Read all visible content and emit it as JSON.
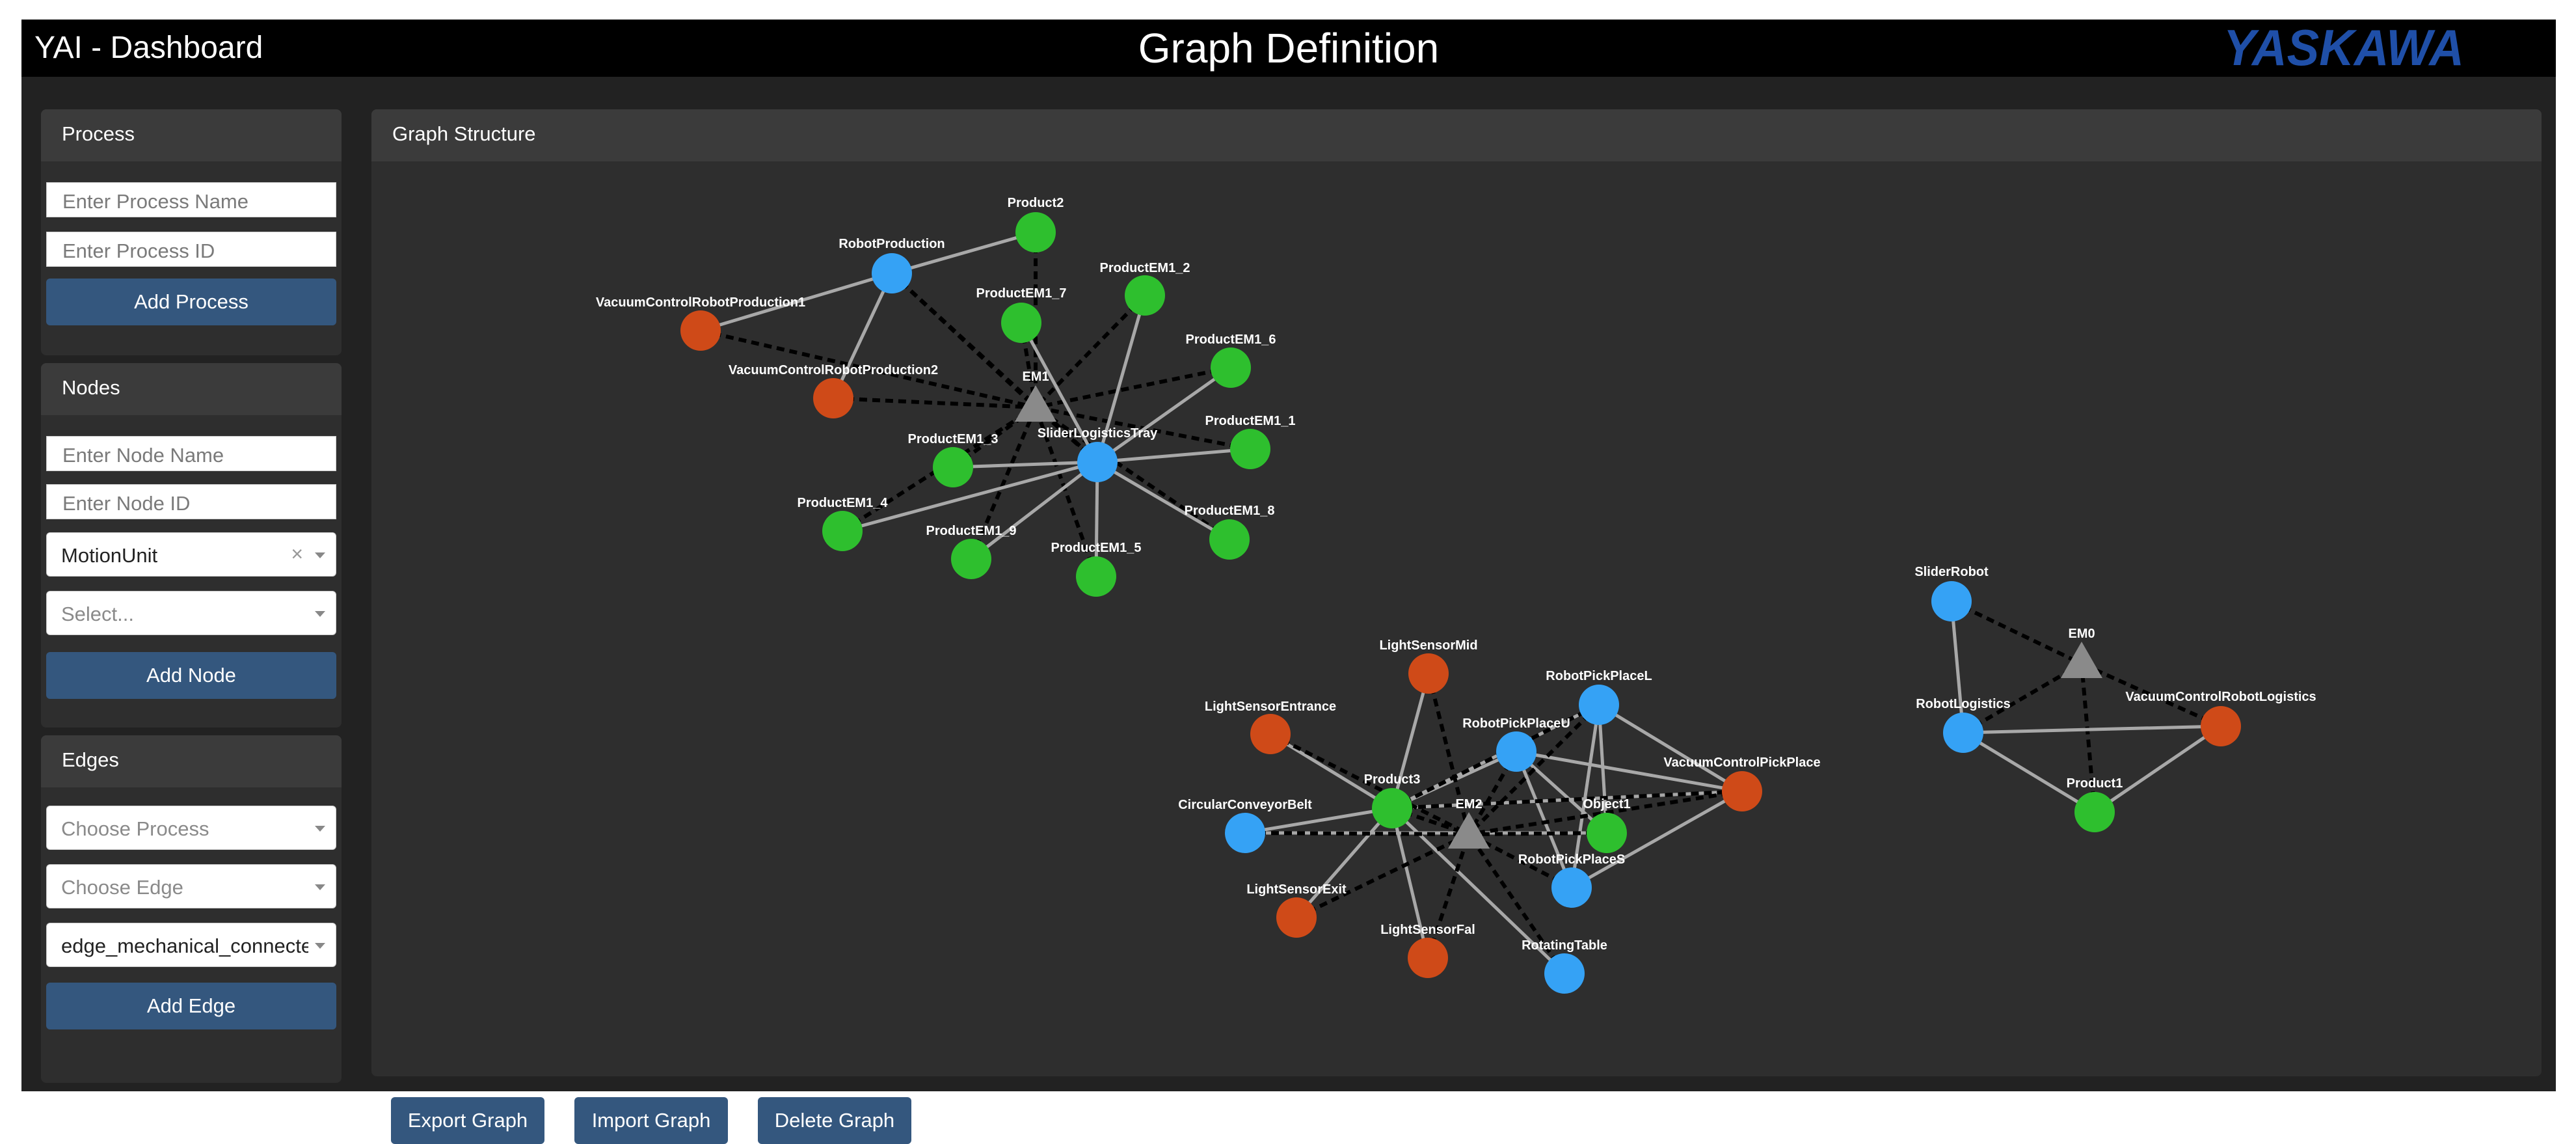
{
  "header": {
    "app_title": "YAI - Dashboard",
    "page_title": "Graph Definition",
    "brand": "YASKAWA"
  },
  "colors": {
    "header_bg": "#000000",
    "panel_bg": "#2e2e2e",
    "panel_header_bg": "#3b3b3b",
    "button_bg": "#34577e",
    "brand_blue": "#1f4fa8",
    "node_blue": "#35a2f5",
    "node_green": "#2ebf2e",
    "node_orange": "#cf4a18",
    "node_gray": "#8a8a8a",
    "edge_solid": "#a8a8a8",
    "edge_dashed": "#000000"
  },
  "sidebar": {
    "process": {
      "title": "Process",
      "name_placeholder": "Enter Process Name",
      "id_placeholder": "Enter Process ID",
      "add_label": "Add Process"
    },
    "nodes": {
      "title": "Nodes",
      "name_placeholder": "Enter Node Name",
      "id_placeholder": "Enter Node ID",
      "type_value": "MotionUnit",
      "clear_glyph": "×",
      "subtype_placeholder": "Select...",
      "add_label": "Add Node"
    },
    "edges": {
      "title": "Edges",
      "process_placeholder": "Choose Process",
      "edge_placeholder": "Choose Edge",
      "edge_type_value": "edge_mechanical_connected",
      "add_label": "Add Edge"
    }
  },
  "main": {
    "title": "Graph Structure",
    "export_label": "Export Graph",
    "import_label": "Import Graph",
    "delete_label": "Delete Graph"
  },
  "graph": {
    "nodes": [
      {
        "id": "Product2",
        "type": "green"
      },
      {
        "id": "RobotProduction",
        "type": "blue"
      },
      {
        "id": "ProductEM1_7",
        "type": "green"
      },
      {
        "id": "ProductEM1_2",
        "type": "green"
      },
      {
        "id": "VacuumControlRobotProduction1",
        "type": "orange"
      },
      {
        "id": "ProductEM1_6",
        "type": "green"
      },
      {
        "id": "VacuumControlRobotProduction2",
        "type": "orange"
      },
      {
        "id": "EM1",
        "type": "gray"
      },
      {
        "id": "SliderLogisticsTray",
        "type": "blue"
      },
      {
        "id": "ProductEM1_1",
        "type": "green"
      },
      {
        "id": "ProductEM1_3",
        "type": "green"
      },
      {
        "id": "ProductEM1_4",
        "type": "green"
      },
      {
        "id": "ProductEM1_8",
        "type": "green"
      },
      {
        "id": "ProductEM1_9",
        "type": "green"
      },
      {
        "id": "ProductEM1_5",
        "type": "green"
      },
      {
        "id": "SliderRobot",
        "type": "blue"
      },
      {
        "id": "EM0",
        "type": "gray"
      },
      {
        "id": "RobotLogistics",
        "type": "blue"
      },
      {
        "id": "VacuumControlRobotLogistics",
        "type": "orange"
      },
      {
        "id": "Product1",
        "type": "green"
      },
      {
        "id": "LightSensorMid",
        "type": "orange"
      },
      {
        "id": "RobotPickPlaceL",
        "type": "blue"
      },
      {
        "id": "LightSensorEntrance",
        "type": "orange"
      },
      {
        "id": "RobotPickPlaceU",
        "type": "blue"
      },
      {
        "id": "VacuumControlPickPlace",
        "type": "orange"
      },
      {
        "id": "Product3",
        "type": "green"
      },
      {
        "id": "CircularConveyorBelt",
        "type": "blue"
      },
      {
        "id": "EM2",
        "type": "gray"
      },
      {
        "id": "Object1",
        "type": "green"
      },
      {
        "id": "RobotPickPlaceS",
        "type": "blue"
      },
      {
        "id": "LightSensorExit",
        "type": "orange"
      },
      {
        "id": "LightSensorFal",
        "type": "orange"
      },
      {
        "id": "RotatingTable",
        "type": "blue"
      }
    ],
    "edges": [
      {
        "from": "RobotProduction",
        "to": "Product2",
        "style": "solid"
      },
      {
        "from": "RobotProduction",
        "to": "VacuumControlRobotProduction1",
        "style": "solid"
      },
      {
        "from": "RobotProduction",
        "to": "VacuumControlRobotProduction2",
        "style": "solid"
      },
      {
        "from": "RobotProduction",
        "to": "SliderLogisticsTray",
        "style": "dashed"
      },
      {
        "from": "RobotProduction",
        "to": "EM1",
        "style": "dashed"
      },
      {
        "from": "VacuumControlRobotProduction1",
        "to": "EM1",
        "style": "dashed"
      },
      {
        "from": "VacuumControlRobotProduction2",
        "to": "EM1",
        "style": "dashed"
      },
      {
        "from": "Product2",
        "to": "EM1",
        "style": "dashed"
      },
      {
        "from": "ProductEM1_7",
        "to": "EM1",
        "style": "dashed"
      },
      {
        "from": "ProductEM1_2",
        "to": "EM1",
        "style": "dashed"
      },
      {
        "from": "ProductEM1_6",
        "to": "EM1",
        "style": "dashed"
      },
      {
        "from": "ProductEM1_1",
        "to": "EM1",
        "style": "dashed"
      },
      {
        "from": "ProductEM1_3",
        "to": "EM1",
        "style": "dashed"
      },
      {
        "from": "ProductEM1_4",
        "to": "EM1",
        "style": "dashed"
      },
      {
        "from": "ProductEM1_8",
        "to": "EM1",
        "style": "dashed"
      },
      {
        "from": "ProductEM1_9",
        "to": "EM1",
        "style": "dashed"
      },
      {
        "from": "ProductEM1_5",
        "to": "EM1",
        "style": "dashed"
      },
      {
        "from": "SliderLogisticsTray",
        "to": "EM1",
        "style": "dashed"
      },
      {
        "from": "SliderLogisticsTray",
        "to": "ProductEM1_7",
        "style": "solid"
      },
      {
        "from": "SliderLogisticsTray",
        "to": "ProductEM1_2",
        "style": "solid"
      },
      {
        "from": "SliderLogisticsTray",
        "to": "ProductEM1_6",
        "style": "solid"
      },
      {
        "from": "SliderLogisticsTray",
        "to": "ProductEM1_1",
        "style": "solid"
      },
      {
        "from": "SliderLogisticsTray",
        "to": "ProductEM1_3",
        "style": "solid"
      },
      {
        "from": "SliderLogisticsTray",
        "to": "ProductEM1_4",
        "style": "solid"
      },
      {
        "from": "SliderLogisticsTray",
        "to": "ProductEM1_8",
        "style": "solid"
      },
      {
        "from": "SliderLogisticsTray",
        "to": "ProductEM1_9",
        "style": "solid"
      },
      {
        "from": "SliderLogisticsTray",
        "to": "ProductEM1_5",
        "style": "solid"
      },
      {
        "from": "SliderRobot",
        "to": "RobotLogistics",
        "style": "solid"
      },
      {
        "from": "SliderRobot",
        "to": "EM0",
        "style": "dashed"
      },
      {
        "from": "RobotLogistics",
        "to": "EM0",
        "style": "dashed"
      },
      {
        "from": "VacuumControlRobotLogistics",
        "to": "EM0",
        "style": "dashed"
      },
      {
        "from": "Product1",
        "to": "EM0",
        "style": "dashed"
      },
      {
        "from": "RobotLogistics",
        "to": "VacuumControlRobotLogistics",
        "style": "solid"
      },
      {
        "from": "RobotLogistics",
        "to": "Product1",
        "style": "solid"
      },
      {
        "from": "Product1",
        "to": "VacuumControlRobotLogistics",
        "style": "solid"
      },
      {
        "from": "LightSensorMid",
        "to": "Product3",
        "style": "solid"
      },
      {
        "from": "LightSensorEntrance",
        "to": "Product3",
        "style": "solid"
      },
      {
        "from": "CircularConveyorBelt",
        "to": "Product3",
        "style": "solid"
      },
      {
        "from": "LightSensorExit",
        "to": "Product3",
        "style": "solid"
      },
      {
        "from": "LightSensorFal",
        "to": "Product3",
        "style": "solid"
      },
      {
        "from": "RotatingTable",
        "to": "Product3",
        "style": "solid"
      },
      {
        "from": "RobotPickPlaceU",
        "to": "Product3",
        "style": "solid"
      },
      {
        "from": "RobotPickPlaceL",
        "to": "Product3",
        "style": "solid"
      },
      {
        "from": "VacuumControlPickPlace",
        "to": "Product3",
        "style": "solid"
      },
      {
        "from": "RobotPickPlaceU",
        "to": "Object1",
        "style": "solid"
      },
      {
        "from": "RobotPickPlaceL",
        "to": "Object1",
        "style": "solid"
      },
      {
        "from": "RobotPickPlaceU",
        "to": "RobotPickPlaceS",
        "style": "solid"
      },
      {
        "from": "RobotPickPlaceL",
        "to": "RobotPickPlaceS",
        "style": "solid"
      },
      {
        "from": "VacuumControlPickPlace",
        "to": "RobotPickPlaceS",
        "style": "solid"
      },
      {
        "from": "VacuumControlPickPlace",
        "to": "RobotPickPlaceU",
        "style": "solid"
      },
      {
        "from": "VacuumControlPickPlace",
        "to": "RobotPickPlaceL",
        "style": "solid"
      },
      {
        "from": "CircularConveyorBelt",
        "to": "Object1",
        "style": "solid"
      },
      {
        "from": "LightSensorMid",
        "to": "EM2",
        "style": "dashed"
      },
      {
        "from": "LightSensorEntrance",
        "to": "EM2",
        "style": "dashed"
      },
      {
        "from": "CircularConveyorBelt",
        "to": "EM2",
        "style": "dashed"
      },
      {
        "from": "LightSensorExit",
        "to": "EM2",
        "style": "dashed"
      },
      {
        "from": "LightSensorFal",
        "to": "EM2",
        "style": "dashed"
      },
      {
        "from": "RotatingTable",
        "to": "EM2",
        "style": "dashed"
      },
      {
        "from": "RobotPickPlaceU",
        "to": "EM2",
        "style": "dashed"
      },
      {
        "from": "RobotPickPlaceL",
        "to": "EM2",
        "style": "dashed"
      },
      {
        "from": "VacuumControlPickPlace",
        "to": "EM2",
        "style": "dashed"
      },
      {
        "from": "Object1",
        "to": "EM2",
        "style": "dashed"
      },
      {
        "from": "RobotPickPlaceS",
        "to": "EM2",
        "style": "dashed"
      },
      {
        "from": "Product3",
        "to": "EM2",
        "style": "dashed"
      },
      {
        "from": "Product3",
        "to": "RobotPickPlaceL",
        "style": "dashed"
      },
      {
        "from": "Product3",
        "to": "VacuumControlPickPlace",
        "style": "dashed"
      }
    ]
  }
}
